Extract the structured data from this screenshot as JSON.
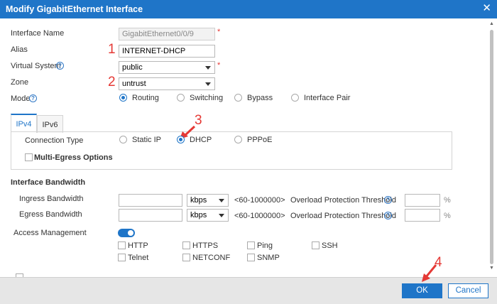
{
  "dialog": {
    "title": "Modify GigabitEthernet Interface",
    "close_glyph": "✕"
  },
  "colors": {
    "accent": "#1f75c8",
    "annotation": "#e53935"
  },
  "form": {
    "interface_name": {
      "label": "Interface Name",
      "value": "GigabitEthernet0/0/9",
      "required_mark": "*"
    },
    "alias": {
      "label": "Alias",
      "value": "INTERNET-DHCP"
    },
    "virtual_system": {
      "label": "Virtual System",
      "value": "public",
      "required_mark": "*",
      "help": "?"
    },
    "zone": {
      "label": "Zone",
      "value": "untrust"
    },
    "mode": {
      "label": "Mode",
      "help": "?",
      "selected": "Routing",
      "options": [
        "Routing",
        "Switching",
        "Bypass",
        "Interface Pair"
      ]
    }
  },
  "tabs": [
    {
      "label": "IPv4",
      "active": true
    },
    {
      "label": "IPv6",
      "active": false
    }
  ],
  "ipv4": {
    "connection_type": {
      "label": "Connection Type",
      "selected": "DHCP",
      "options": [
        "Static IP",
        "DHCP",
        "PPPoE"
      ]
    },
    "multi_egress": {
      "label": "Multi-Egress Options",
      "checked": false
    }
  },
  "bandwidth": {
    "section_title": "Interface Bandwidth",
    "rows": [
      {
        "label": "Ingress Bandwidth",
        "value": "",
        "unit": "kbps",
        "range": "<60-1000000>",
        "threshold_label": "Overload Protection Threshold",
        "threshold_value": "",
        "percent": "%"
      },
      {
        "label": "Egress Bandwidth",
        "value": "",
        "unit": "kbps",
        "range": "<60-1000000>",
        "threshold_label": "Overload Protection Threshold",
        "threshold_value": "",
        "percent": "%"
      }
    ],
    "help": "?"
  },
  "access": {
    "label": "Access Management",
    "enabled": true,
    "options": [
      {
        "label": "HTTP",
        "checked": false
      },
      {
        "label": "HTTPS",
        "checked": false
      },
      {
        "label": "Ping",
        "checked": false
      },
      {
        "label": "SSH",
        "checked": false
      },
      {
        "label": "Telnet",
        "checked": false
      },
      {
        "label": "NETCONF",
        "checked": false
      },
      {
        "label": "SNMP",
        "checked": false
      }
    ]
  },
  "annotations": [
    "1",
    "2",
    "3",
    "4"
  ],
  "footer": {
    "ok_label": "OK",
    "cancel_label": "Cancel"
  }
}
